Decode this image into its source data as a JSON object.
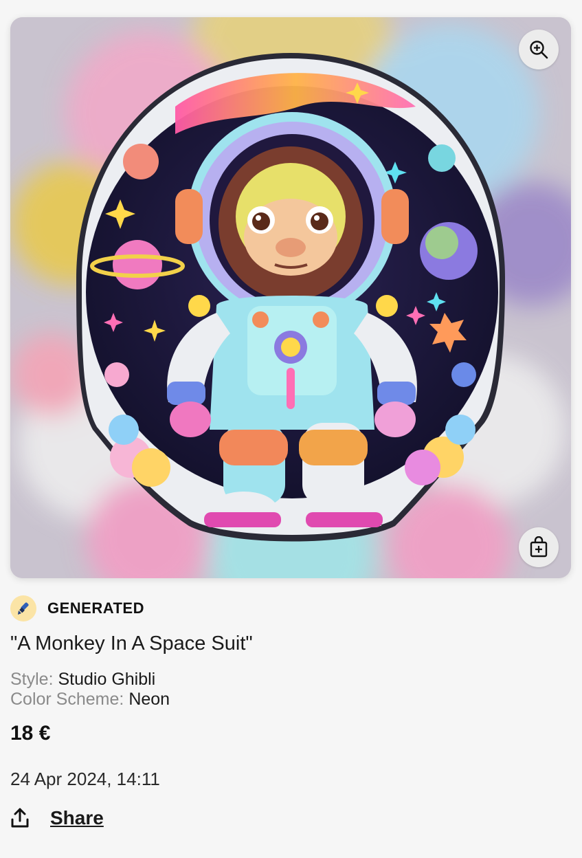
{
  "image": {
    "alt": "",
    "colors": {
      "space": "#16132e",
      "suit": "#8fe0ea",
      "sticker_border": "#e9e9ee",
      "blur_bg": "#c7c1cc"
    }
  },
  "actions": {
    "zoom_icon": "zoom-in-icon",
    "add_to_bag_icon": "shopping-bag-plus-icon"
  },
  "badge": {
    "icon": "paintbrush-icon",
    "label": "GENERATED"
  },
  "product": {
    "title": "\"A Monkey In A Space Suit\"",
    "style_label": "Style:",
    "style_value": "Studio Ghibli",
    "color_scheme_label": "Color Scheme:",
    "color_scheme_value": "Neon",
    "price": "18 €",
    "date": "24 Apr 2024, 14:11"
  },
  "share": {
    "icon": "share-upload-icon",
    "label": "Share"
  }
}
